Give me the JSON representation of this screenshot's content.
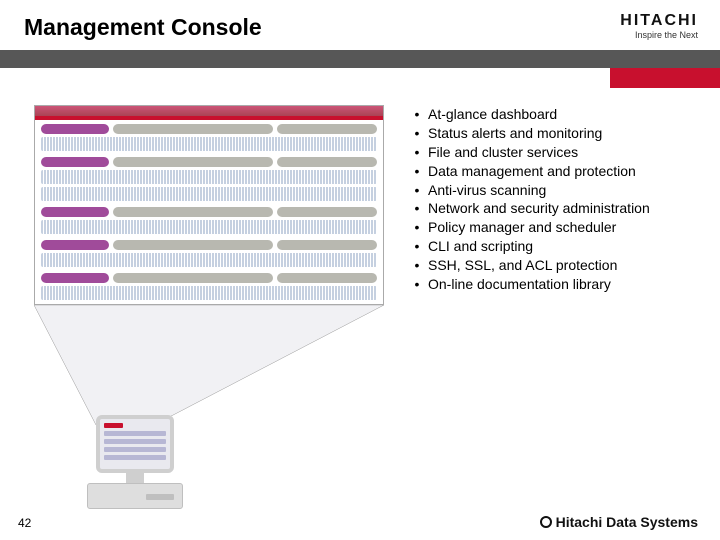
{
  "title": "Management Console",
  "logo_top": {
    "name": "HITACHI",
    "tagline": "Inspire the Next"
  },
  "bullets": [
    "At-glance dashboard",
    "Status alerts and monitoring",
    "File and cluster services",
    "Data management and protection",
    "Anti-virus scanning",
    "Network and security administration",
    "Policy manager and scheduler",
    "CLI and scripting",
    "SSH, SSL, and ACL protection",
    "On-line documentation library"
  ],
  "page_number": "42",
  "footer_logo": "Hitachi Data Systems"
}
